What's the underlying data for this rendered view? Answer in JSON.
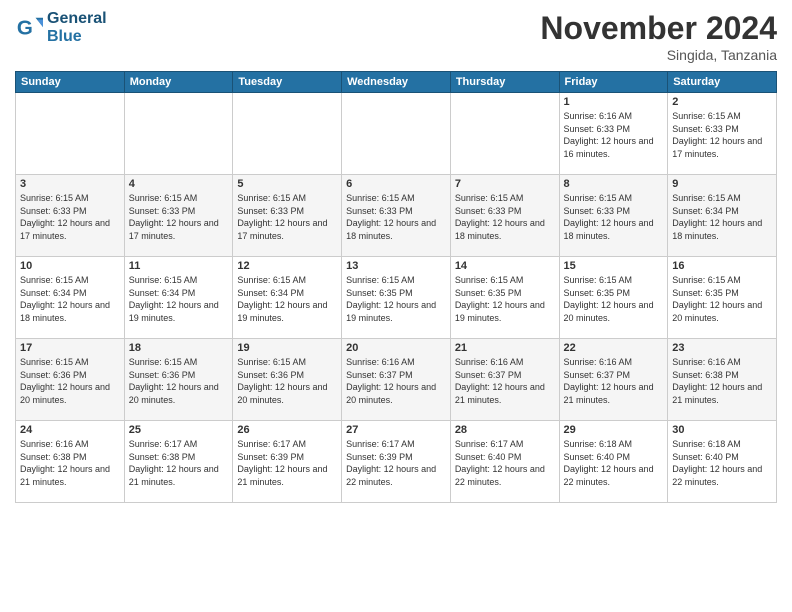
{
  "logo": {
    "line1": "General",
    "line2": "Blue"
  },
  "header": {
    "title": "November 2024",
    "subtitle": "Singida, Tanzania"
  },
  "weekdays": [
    "Sunday",
    "Monday",
    "Tuesday",
    "Wednesday",
    "Thursday",
    "Friday",
    "Saturday"
  ],
  "weeks": [
    [
      {
        "day": "",
        "info": ""
      },
      {
        "day": "",
        "info": ""
      },
      {
        "day": "",
        "info": ""
      },
      {
        "day": "",
        "info": ""
      },
      {
        "day": "",
        "info": ""
      },
      {
        "day": "1",
        "info": "Sunrise: 6:16 AM\nSunset: 6:33 PM\nDaylight: 12 hours and 16 minutes."
      },
      {
        "day": "2",
        "info": "Sunrise: 6:15 AM\nSunset: 6:33 PM\nDaylight: 12 hours and 17 minutes."
      }
    ],
    [
      {
        "day": "3",
        "info": "Sunrise: 6:15 AM\nSunset: 6:33 PM\nDaylight: 12 hours and 17 minutes."
      },
      {
        "day": "4",
        "info": "Sunrise: 6:15 AM\nSunset: 6:33 PM\nDaylight: 12 hours and 17 minutes."
      },
      {
        "day": "5",
        "info": "Sunrise: 6:15 AM\nSunset: 6:33 PM\nDaylight: 12 hours and 17 minutes."
      },
      {
        "day": "6",
        "info": "Sunrise: 6:15 AM\nSunset: 6:33 PM\nDaylight: 12 hours and 18 minutes."
      },
      {
        "day": "7",
        "info": "Sunrise: 6:15 AM\nSunset: 6:33 PM\nDaylight: 12 hours and 18 minutes."
      },
      {
        "day": "8",
        "info": "Sunrise: 6:15 AM\nSunset: 6:33 PM\nDaylight: 12 hours and 18 minutes."
      },
      {
        "day": "9",
        "info": "Sunrise: 6:15 AM\nSunset: 6:34 PM\nDaylight: 12 hours and 18 minutes."
      }
    ],
    [
      {
        "day": "10",
        "info": "Sunrise: 6:15 AM\nSunset: 6:34 PM\nDaylight: 12 hours and 18 minutes."
      },
      {
        "day": "11",
        "info": "Sunrise: 6:15 AM\nSunset: 6:34 PM\nDaylight: 12 hours and 19 minutes."
      },
      {
        "day": "12",
        "info": "Sunrise: 6:15 AM\nSunset: 6:34 PM\nDaylight: 12 hours and 19 minutes."
      },
      {
        "day": "13",
        "info": "Sunrise: 6:15 AM\nSunset: 6:35 PM\nDaylight: 12 hours and 19 minutes."
      },
      {
        "day": "14",
        "info": "Sunrise: 6:15 AM\nSunset: 6:35 PM\nDaylight: 12 hours and 19 minutes."
      },
      {
        "day": "15",
        "info": "Sunrise: 6:15 AM\nSunset: 6:35 PM\nDaylight: 12 hours and 20 minutes."
      },
      {
        "day": "16",
        "info": "Sunrise: 6:15 AM\nSunset: 6:35 PM\nDaylight: 12 hours and 20 minutes."
      }
    ],
    [
      {
        "day": "17",
        "info": "Sunrise: 6:15 AM\nSunset: 6:36 PM\nDaylight: 12 hours and 20 minutes."
      },
      {
        "day": "18",
        "info": "Sunrise: 6:15 AM\nSunset: 6:36 PM\nDaylight: 12 hours and 20 minutes."
      },
      {
        "day": "19",
        "info": "Sunrise: 6:15 AM\nSunset: 6:36 PM\nDaylight: 12 hours and 20 minutes."
      },
      {
        "day": "20",
        "info": "Sunrise: 6:16 AM\nSunset: 6:37 PM\nDaylight: 12 hours and 20 minutes."
      },
      {
        "day": "21",
        "info": "Sunrise: 6:16 AM\nSunset: 6:37 PM\nDaylight: 12 hours and 21 minutes."
      },
      {
        "day": "22",
        "info": "Sunrise: 6:16 AM\nSunset: 6:37 PM\nDaylight: 12 hours and 21 minutes."
      },
      {
        "day": "23",
        "info": "Sunrise: 6:16 AM\nSunset: 6:38 PM\nDaylight: 12 hours and 21 minutes."
      }
    ],
    [
      {
        "day": "24",
        "info": "Sunrise: 6:16 AM\nSunset: 6:38 PM\nDaylight: 12 hours and 21 minutes."
      },
      {
        "day": "25",
        "info": "Sunrise: 6:17 AM\nSunset: 6:38 PM\nDaylight: 12 hours and 21 minutes."
      },
      {
        "day": "26",
        "info": "Sunrise: 6:17 AM\nSunset: 6:39 PM\nDaylight: 12 hours and 21 minutes."
      },
      {
        "day": "27",
        "info": "Sunrise: 6:17 AM\nSunset: 6:39 PM\nDaylight: 12 hours and 22 minutes."
      },
      {
        "day": "28",
        "info": "Sunrise: 6:17 AM\nSunset: 6:40 PM\nDaylight: 12 hours and 22 minutes."
      },
      {
        "day": "29",
        "info": "Sunrise: 6:18 AM\nSunset: 6:40 PM\nDaylight: 12 hours and 22 minutes."
      },
      {
        "day": "30",
        "info": "Sunrise: 6:18 AM\nSunset: 6:40 PM\nDaylight: 12 hours and 22 minutes."
      }
    ]
  ]
}
